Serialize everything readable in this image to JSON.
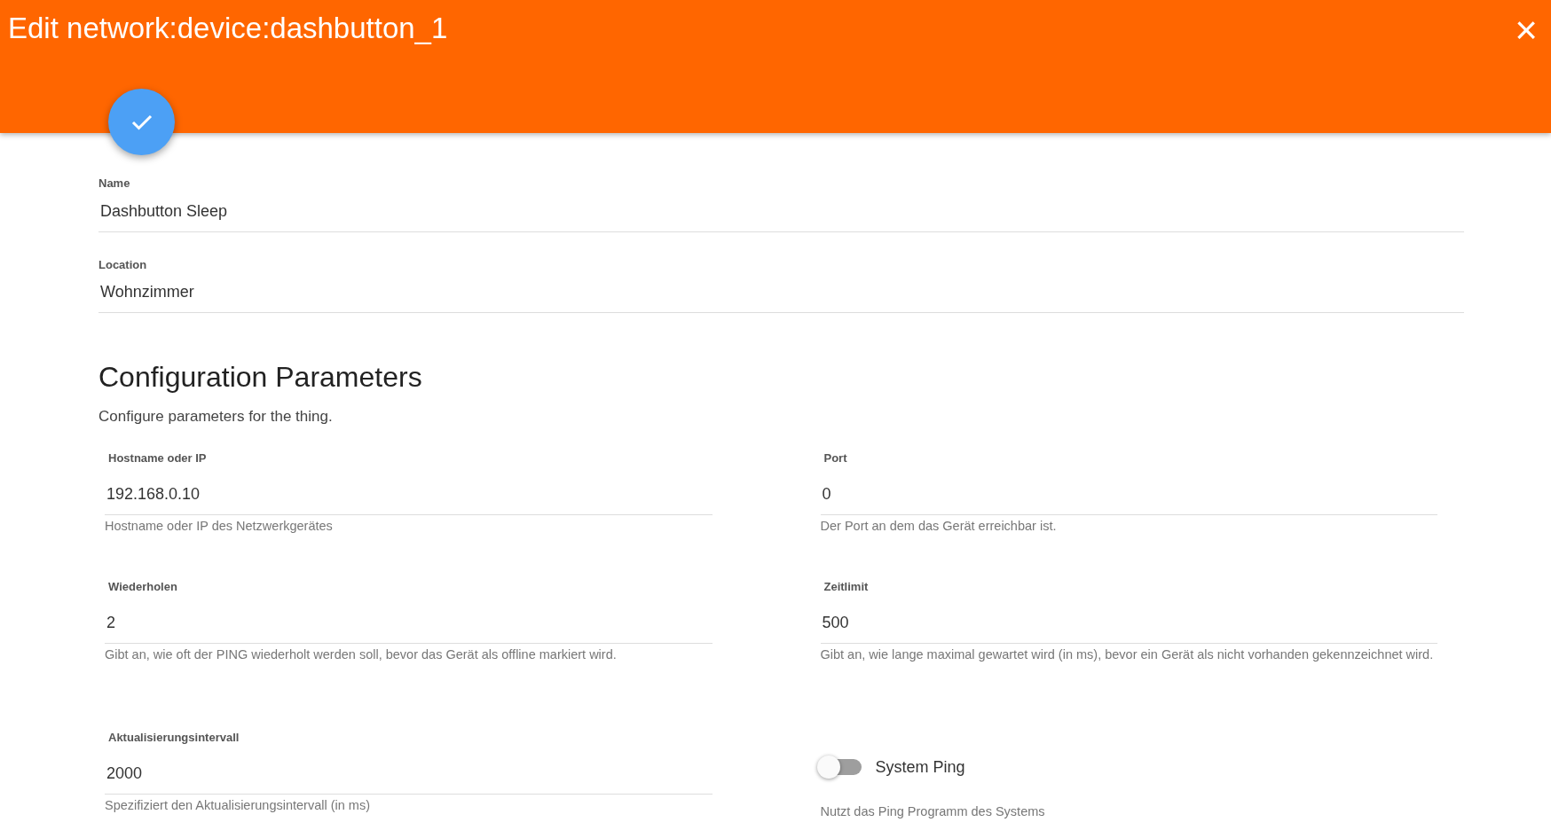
{
  "header": {
    "title": "Edit network:device:dashbutton_1",
    "close": "×"
  },
  "fields": [
    {
      "label": "Name",
      "value": "Dashbutton Sleep"
    },
    {
      "label": "Location",
      "value": "Wohnzimmer"
    }
  ],
  "config": {
    "title": "Configuration Parameters",
    "description": "Configure parameters for the thing.",
    "parameters": [
      {
        "kind": "text",
        "label": "Hostname oder IP",
        "value": "192.168.0.10",
        "hint": "Hostname oder IP des Netzwerkgerätes"
      },
      {
        "kind": "text",
        "label": "Port",
        "value": "0",
        "hint": "Der Port an dem das Gerät erreichbar ist."
      },
      {
        "kind": "text",
        "label": "Wiederholen",
        "value": "2",
        "hint": "Gibt an, wie oft der PING wiederholt werden soll, bevor das Gerät als offline markiert wird."
      },
      {
        "kind": "text",
        "label": "Zeitlimit",
        "value": "500",
        "hint": "Gibt an, wie lange maximal gewartet wird (in ms), bevor ein Gerät als nicht vorhanden gekennzeichnet wird."
      },
      {
        "kind": "text",
        "label": "Aktualisierungsintervall",
        "value": "2000",
        "hint": "Spezifiziert den Aktualisierungsintervall (in ms)"
      },
      {
        "kind": "toggle",
        "label": "System Ping",
        "on": false,
        "hint": "Nutzt das Ping Programm des Systems"
      }
    ]
  }
}
